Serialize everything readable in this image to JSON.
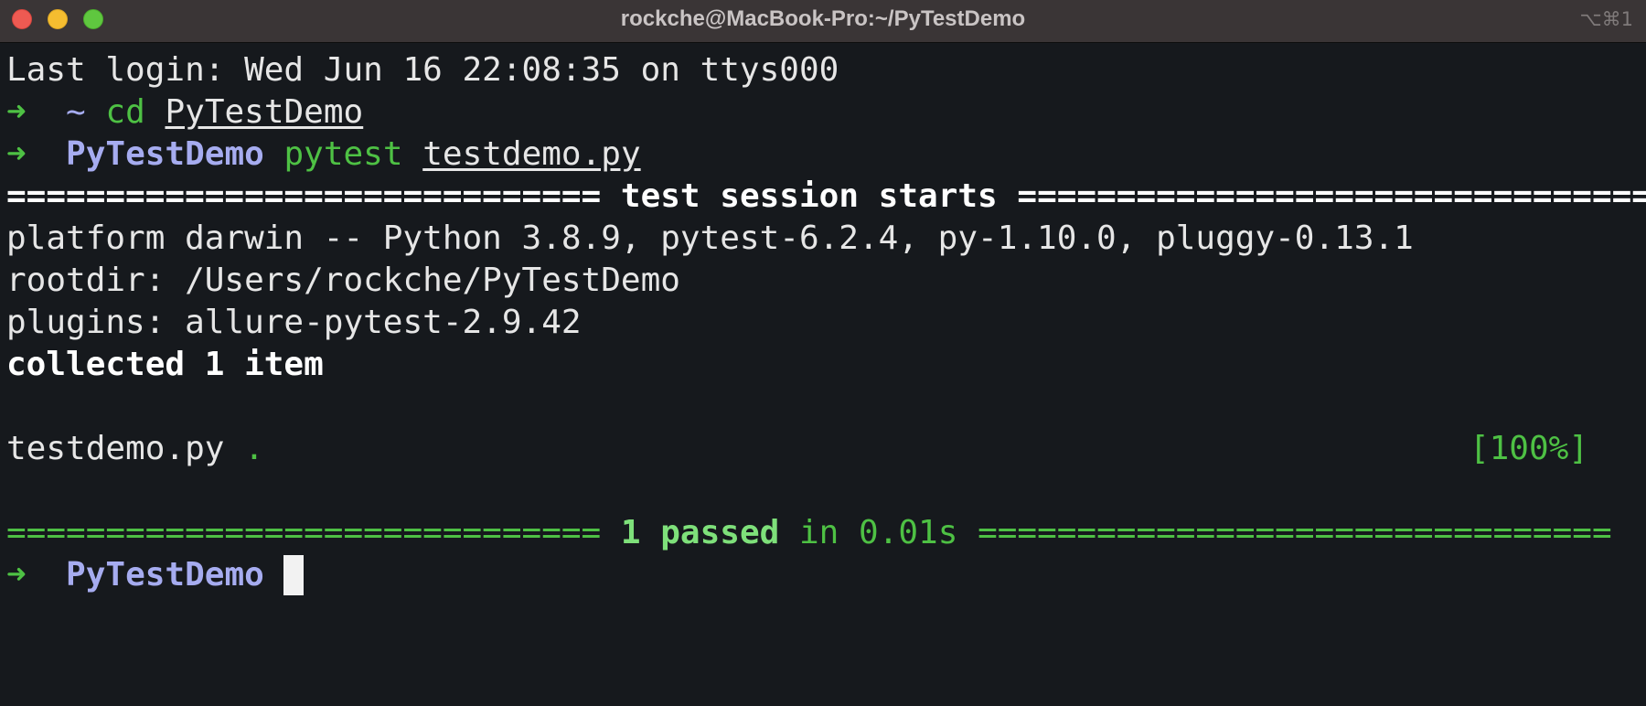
{
  "window": {
    "title": "rockche@MacBook-Pro:~/PyTestDemo",
    "shortcut": "⌥⌘1"
  },
  "terminal": {
    "last_login": "Last login: Wed Jun 16 22:08:35 on ttys000",
    "prompt_arrow": "➜",
    "line2": {
      "dir": "~",
      "cmd": "cd",
      "arg": "PyTestDemo"
    },
    "line3": {
      "dir": "PyTestDemo",
      "cmd": "pytest",
      "arg": "testdemo.py"
    },
    "session_left": "==============================",
    "session_text": "test session starts",
    "session_right": "================================",
    "platform": "platform darwin -- Python 3.8.9, pytest-6.2.4, py-1.10.0, pluggy-0.13.1",
    "rootdir": "rootdir: /Users/rockche/PyTestDemo",
    "plugins": "plugins: allure-pytest-2.9.42",
    "collected": "collected 1 item",
    "test_file": "testdemo.py",
    "test_result": ".",
    "progress": "[100%]",
    "summary_left": "==============================",
    "summary_passed": "1 passed",
    "summary_time": "in 0.01s",
    "summary_right": "================================",
    "final_dir": "PyTestDemo"
  },
  "colors": {
    "background": "#16191d",
    "titlebar": "#3a3536",
    "prompt_green": "#4ec144",
    "dir_blue": "#a6acf0",
    "text": "#e6e6e6"
  }
}
